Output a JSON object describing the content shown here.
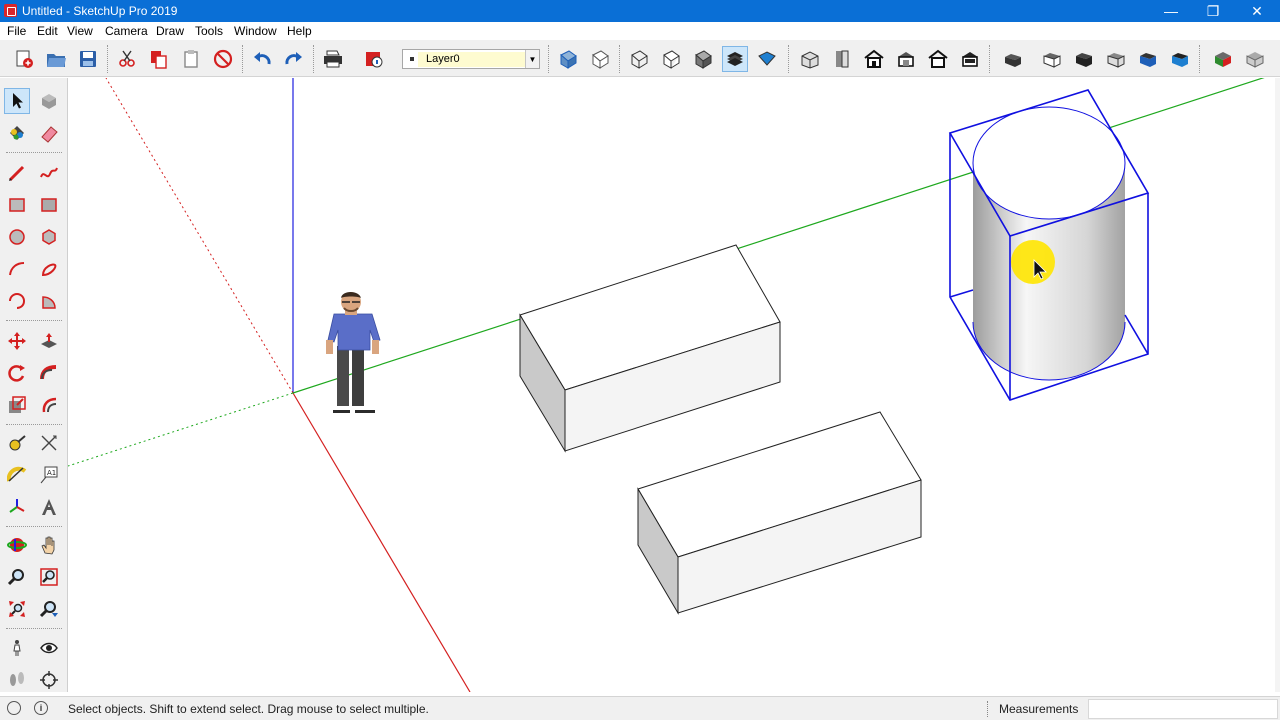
{
  "window": {
    "title": "Untitled - SketchUp Pro 2019",
    "minimize_glyph": "—",
    "restore_glyph": "❐",
    "close_glyph": "✕"
  },
  "menu": [
    {
      "label": "File"
    },
    {
      "label": "Edit"
    },
    {
      "label": "View"
    },
    {
      "label": "Camera"
    },
    {
      "label": "Draw"
    },
    {
      "label": "Tools"
    },
    {
      "label": "Window"
    },
    {
      "label": "Help"
    }
  ],
  "toolbar": {
    "layer_selected": "Layer0",
    "tools": [
      "new-file-icon",
      "open-folder-icon",
      "save-icon",
      "cut-icon",
      "copy-icon",
      "paste-icon",
      "erase-icon",
      "undo-icon",
      "redo-icon",
      "print-icon",
      "model-info-icon",
      "xray-icon",
      "back-edges-icon",
      "wireframe-icon",
      "hidden-line-icon",
      "shaded-icon",
      "shaded-textures-icon",
      "monochrome-icon",
      "iso-view-icon",
      "top-view-icon",
      "front-view-icon",
      "right-view-icon",
      "back-view-icon",
      "left-view-icon",
      "component-icon-1",
      "component-icon-2",
      "component-icon-3",
      "component-icon-4",
      "component-icon-5",
      "component-icon-6",
      "extension-icon-1",
      "extension-icon-2"
    ]
  },
  "left_tools": [
    "select-icon",
    "make-component-icon",
    "paint-bucket-icon",
    "eraser-icon",
    "line-icon",
    "freehand-icon",
    "rectangle-icon",
    "rotated-rectangle-icon",
    "circle-icon",
    "polygon-icon",
    "arc-icon",
    "two-point-arc-icon",
    "three-point-arc-icon",
    "pie-icon",
    "move-icon",
    "push-pull-icon",
    "rotate-icon",
    "follow-me-icon",
    "scale-icon",
    "offset-icon",
    "tape-measure-icon",
    "dimension-icon",
    "protractor-icon",
    "text-icon",
    "axes-icon",
    "3d-text-icon",
    "orbit-icon",
    "pan-icon",
    "zoom-icon",
    "zoom-window-icon",
    "zoom-extents-icon",
    "previous-view-icon",
    "position-camera-icon",
    "look-around-icon",
    "walk-icon",
    "section-plane-icon"
  ],
  "status": {
    "message": "Select objects. Shift to extend select. Drag mouse to select multiple.",
    "measurements_label": "Measurements",
    "geo_icon": "geo-location-icon",
    "credits_icon": "credits-icon",
    "credits_glyph": "i"
  },
  "colors": {
    "title_bar": "#0a6fd6",
    "red_axis": "#d42020",
    "green_axis": "#1ea81e",
    "blue_axis": "#2020e0",
    "selection": "#1010e0",
    "cursor_highlight": "#ffe600"
  }
}
